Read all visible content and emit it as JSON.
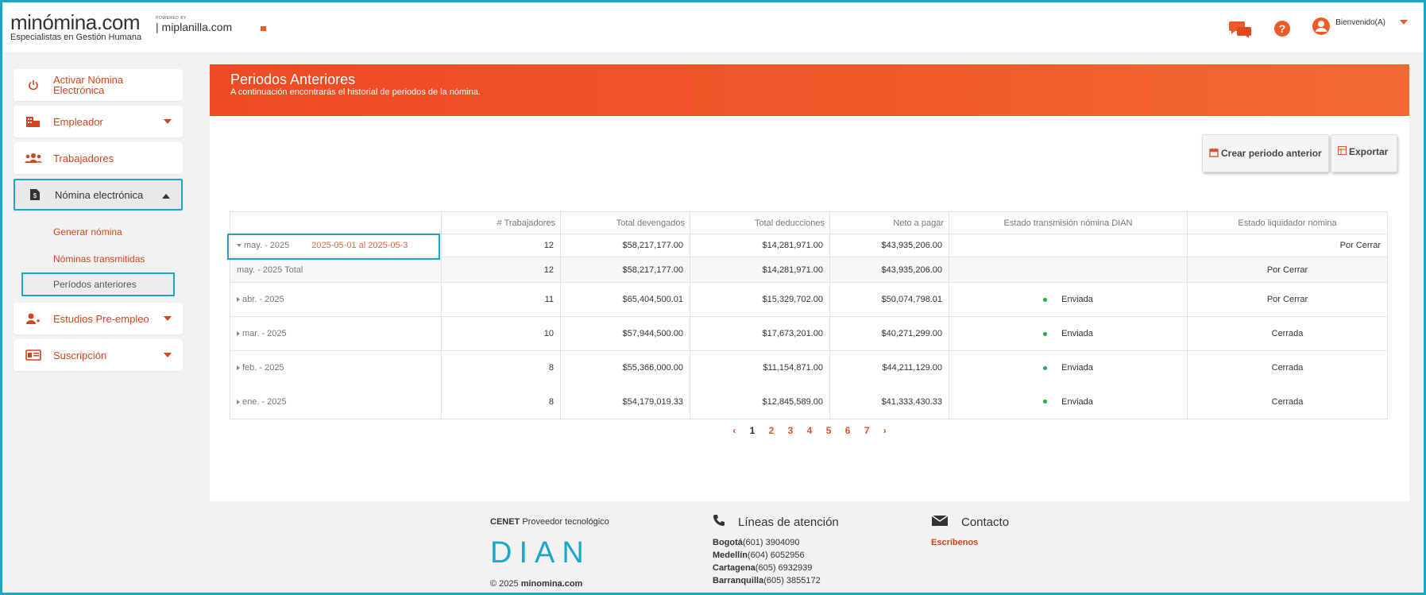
{
  "header": {
    "logo_main": "minómina.com",
    "logo_sub": "Especialistas en Gestión Humana",
    "powered_label": "POWERED BY",
    "powered_name": "| miplanilla.com",
    "user_greeting": "Bienvenido(A)"
  },
  "sidebar": {
    "items": [
      {
        "label": "Activar Nómina Electrónica",
        "icon": "power-icon"
      },
      {
        "label": "Empleador",
        "icon": "building-icon"
      },
      {
        "label": "Trabajadores",
        "icon": "users-icon"
      },
      {
        "label": "Nómina electrónica",
        "icon": "document-icon"
      },
      {
        "label": "Estudios Pre-empleo",
        "icon": "user-plus-icon"
      },
      {
        "label": "Suscripción",
        "icon": "id-card-icon"
      }
    ],
    "sub_items": [
      "Generar nómina",
      "Nóminas transmitidas",
      "Períodos anteriores"
    ]
  },
  "main": {
    "title": "Periodos Anteriores",
    "subtitle": "A continuación encontrarás el historial de periodos de la nómina.",
    "create_button": "Crear periodo anterior",
    "export_button": "Exportar"
  },
  "table": {
    "headers": [
      "",
      "# Trabajadores",
      "Total devengados",
      "Total deducciones",
      "Neto a pagar",
      "Estado transmisión nómina DIAN",
      "Estado liquidador nomina"
    ],
    "rows": [
      {
        "period": "may. - 2025",
        "range": "2025-05-01 al 2025-05-3",
        "workers": "12",
        "devengados": "$58,217,177.00",
        "deducciones": "$14,281,971.00",
        "neto": "$43,935,206.00",
        "dian": "",
        "liquidador": "Por Cerrar"
      },
      {
        "period": "may. - 2025 Total",
        "workers": "12",
        "devengados": "$58,217,177.00",
        "deducciones": "$14,281,971.00",
        "neto": "$43,935,206.00",
        "dian": "",
        "liquidador": "Por Cerrar"
      },
      {
        "period": "abr. - 2025",
        "workers": "11",
        "devengados": "$65,404,500.01",
        "deducciones": "$15,329,702.00",
        "neto": "$50,074,798.01",
        "dian": "Enviada",
        "liquidador": "Por Cerrar"
      },
      {
        "period": "mar. - 2025",
        "workers": "10",
        "devengados": "$57,944,500.00",
        "deducciones": "$17,673,201.00",
        "neto": "$40,271,299.00",
        "dian": "Enviada",
        "liquidador": "Cerrada"
      },
      {
        "period": "feb. - 2025",
        "workers": "8",
        "devengados": "$55,366,000.00",
        "deducciones": "$11,154,871.00",
        "neto": "$44,211,129.00",
        "dian": "Enviada",
        "liquidador": "Cerrada"
      },
      {
        "period": "ene. - 2025",
        "workers": "8",
        "devengados": "$54,179,019.33",
        "deducciones": "$12,845,589.00",
        "neto": "$41,333,430.33",
        "dian": "Enviada",
        "liquidador": "Cerrada"
      }
    ]
  },
  "pagination": {
    "prev": "‹",
    "pages": [
      "1",
      "2",
      "3",
      "4",
      "5",
      "6",
      "7"
    ],
    "next": "›"
  },
  "footer": {
    "provider_bold": "CENET",
    "provider_text": " Proveedor tecnológico",
    "dian_logo": "DIAN",
    "copyright_prefix": "© 2025 ",
    "copyright_site": "minomina.com",
    "lines_title": "Líneas de atención",
    "lines": [
      {
        "city": "Bogotá",
        "phone": "(601) 3904090"
      },
      {
        "city": "Medellín",
        "phone": "(604) 6052956"
      },
      {
        "city": "Cartagena",
        "phone": "(605) 6932939"
      },
      {
        "city": "Barranquilla",
        "phone": "(605) 3855172"
      }
    ],
    "contact_title": "Contacto",
    "contact_link": "Escríbenos"
  },
  "colors": {
    "accent": "#f05a28",
    "highlight": "#1aa7c4",
    "success": "#3a9a4a"
  }
}
